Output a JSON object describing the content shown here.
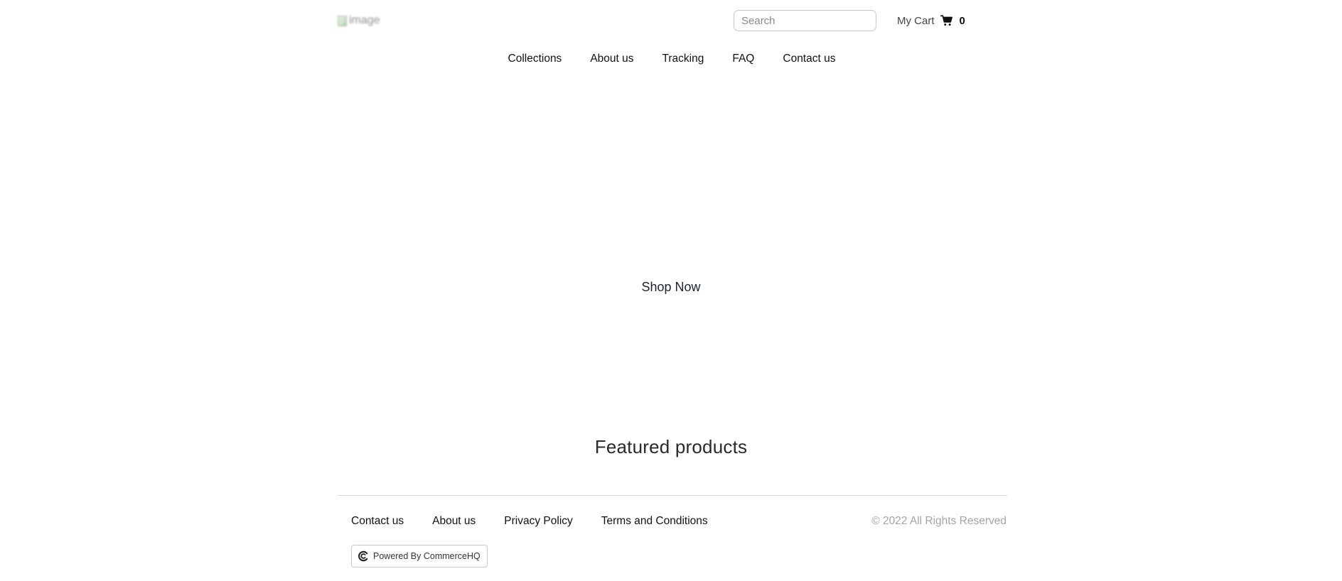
{
  "header": {
    "logo_alt": "image",
    "search": {
      "placeholder": "Search",
      "value": ""
    },
    "cart": {
      "label": "My Cart",
      "icon": "cart-icon",
      "count": "0"
    }
  },
  "nav": {
    "items": [
      {
        "label": "Collections"
      },
      {
        "label": "About us"
      },
      {
        "label": "Tracking"
      },
      {
        "label": "FAQ"
      },
      {
        "label": "Contact us"
      }
    ]
  },
  "hero": {
    "cta_label": "Shop Now"
  },
  "featured": {
    "title": "Featured products"
  },
  "footer": {
    "links": [
      {
        "label": "Contact us"
      },
      {
        "label": "About us"
      },
      {
        "label": "Privacy Policy"
      },
      {
        "label": "Terms and Conditions"
      }
    ],
    "copyright": "© 2022 All Rights Reserved",
    "powered_by": {
      "label": "Powered By CommerceHQ",
      "icon": "commercehq-logo-icon"
    }
  },
  "colors": {
    "text": "#111111",
    "muted": "#a4a4a4",
    "border": "#c8c8c8"
  }
}
